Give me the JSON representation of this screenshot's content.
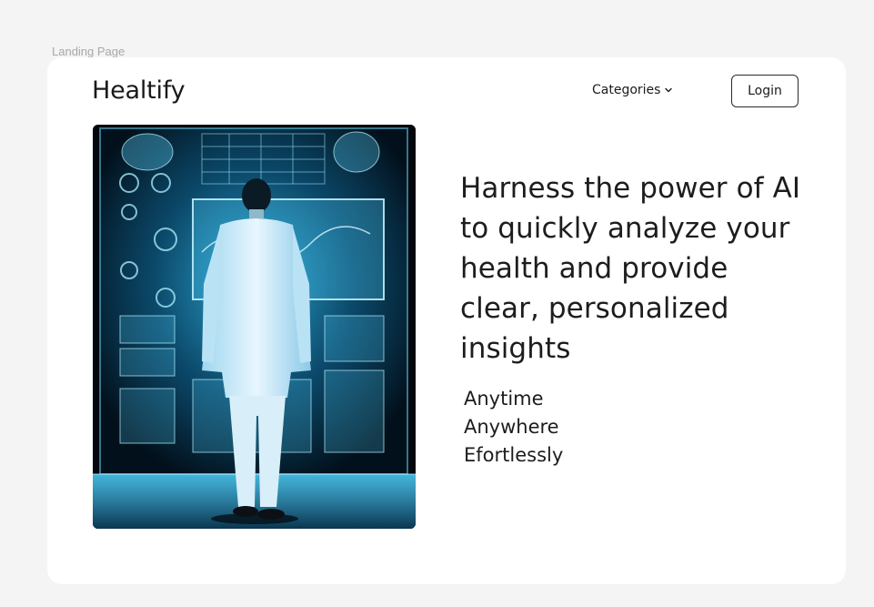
{
  "frame": {
    "label": "Landing Page"
  },
  "header": {
    "logo": "Healtify",
    "categories_label": "Categories",
    "login_label": "Login"
  },
  "hero": {
    "image_description_icon": "doctor-viewing-holographic-screens-image",
    "headline": "Harness the power of AI to quickly analyze your health and provide clear, personalized insights",
    "taglines": [
      "Anytime",
      "Anywhere",
      "Efortlessly"
    ]
  },
  "colors": {
    "background": "#f4f4f4",
    "card": "#ffffff",
    "text": "#1d1d1d",
    "image_glow": "#4fd3ff"
  }
}
